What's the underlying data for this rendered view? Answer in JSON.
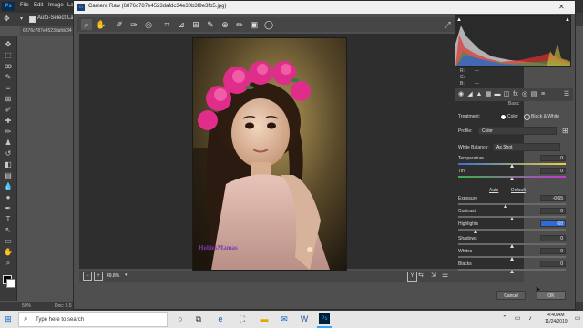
{
  "photoshop": {
    "logo": "Ps",
    "menu": [
      "File",
      "Edit",
      "Image",
      "La"
    ],
    "options": {
      "auto_select": "Auto-Select:",
      "layer": "La"
    },
    "doc_tab": "6876c787e4523dafdc34",
    "status": {
      "zoom": "50%",
      "doc": "Doc: 3.5"
    }
  },
  "camera_raw": {
    "title": "Camera Raw (6876c787e4523dafdc34e30b3f9e3fb5.jpg)",
    "zoom": "49.8%",
    "histogram_readout": {
      "r": "R:",
      "g": "G:",
      "b": "B:",
      "dash": "---"
    },
    "panel_heading": "Basic",
    "treatment_label": "Treatment:",
    "treatment_options": [
      "Color",
      "Black & White"
    ],
    "treatment_selected": "Color",
    "profile_label": "Profile:",
    "profile_value": "Color",
    "wb_label": "White Balance:",
    "wb_value": "As Shot",
    "auto": "Auto",
    "default": "Default",
    "sliders": [
      {
        "label": "Temperature",
        "value": "0",
        "level": 0.5
      },
      {
        "label": "Tint",
        "value": "0",
        "level": 0.5
      },
      {
        "label": "Exposure",
        "value": "-0.65",
        "level": 0.44
      },
      {
        "label": "Contrast",
        "value": "0",
        "level": 0.5
      },
      {
        "label": "Highlights",
        "value": "-68",
        "level": 0.16
      },
      {
        "label": "Shadows",
        "value": "0",
        "level": 0.5
      },
      {
        "label": "Whites",
        "value": "0",
        "level": 0.5
      },
      {
        "label": "Blacks",
        "value": "0",
        "level": 0.5
      }
    ],
    "cancel": "Cancel",
    "ok": "OK",
    "watermark": "HobiesMamas"
  },
  "taskbar": {
    "search_placeholder": "Type here to search",
    "time": "4:40 AM",
    "date": "11/24/2019"
  },
  "colors": {
    "accent": "#31a8ff",
    "highlight_field": "#2d6bd6"
  }
}
